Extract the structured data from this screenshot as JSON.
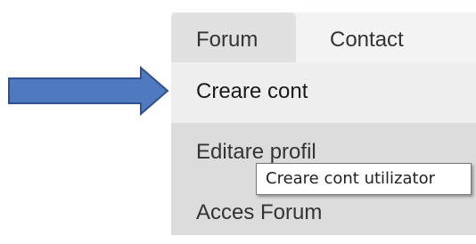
{
  "nav": {
    "tabs": [
      {
        "label": "Forum"
      },
      {
        "label": "Contact"
      }
    ],
    "menu": [
      {
        "label": "Creare cont"
      },
      {
        "label": "Editare profil"
      },
      {
        "label": "Acces Forum"
      }
    ]
  },
  "tooltip": {
    "text": "Creare cont utilizator"
  },
  "annotation": {
    "icon": "right-arrow",
    "color": "#4a72b0"
  }
}
